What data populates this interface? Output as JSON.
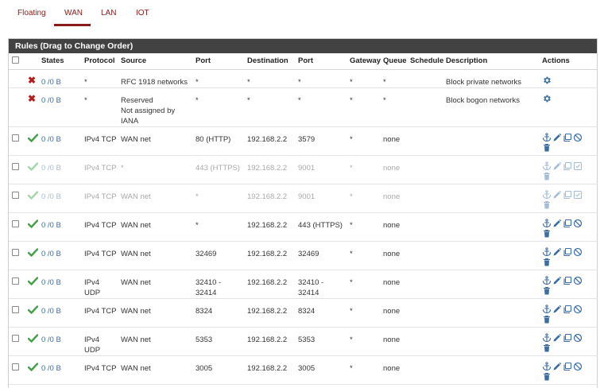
{
  "tabs": [
    {
      "label": "Floating"
    },
    {
      "label": "WAN",
      "active": true
    },
    {
      "label": "LAN"
    },
    {
      "label": "IOT"
    }
  ],
  "panel_title": "Rules (Drag to Change Order)",
  "columns": [
    "States",
    "Protocol",
    "Source",
    "Port",
    "Destination",
    "Port",
    "Gateway",
    "Queue",
    "Schedule",
    "Description",
    "Actions"
  ],
  "colors": {
    "accent": "#8b1a1a",
    "header_bg": "#424242",
    "link": "#3a6ea5",
    "pass_green": "#43a047",
    "block_red": "#b71c1c"
  },
  "rules": [
    {
      "kind": "block",
      "states": "0 /0 B",
      "protocol": "*",
      "source_lines": [
        "RFC 1918 networks"
      ],
      "port": "*",
      "destination": "*",
      "dest_port": "*",
      "gateway": "*",
      "queue": "*",
      "schedule": "",
      "description": "Block private networks",
      "action_icons": "settings"
    },
    {
      "kind": "block",
      "states": "0 /0 B",
      "protocol": "*",
      "source_lines": [
        "Reserved",
        "Not assigned by",
        "IANA"
      ],
      "port": "*",
      "destination": "*",
      "dest_port": "*",
      "gateway": "*",
      "queue": "*",
      "schedule": "",
      "description": "Block bogon networks",
      "action_icons": "settings"
    },
    {
      "kind": "pass",
      "states": "0 /0 B",
      "protocol": "IPv4 TCP",
      "source_lines": [
        "WAN net"
      ],
      "port": "80 (HTTP)",
      "destination": "192.168.2.2",
      "dest_port": "3579",
      "gateway": "*",
      "queue": "none",
      "schedule": "",
      "description": "",
      "action_icons": "enabled"
    },
    {
      "kind": "pass-disabled",
      "states": "0 /0 B",
      "protocol": "IPv4 TCP",
      "source_lines": [
        "*"
      ],
      "port": "443 (HTTPS)",
      "destination": "192.168.2.2",
      "dest_port": "9001",
      "gateway": "*",
      "queue": "none",
      "schedule": "",
      "description": "",
      "action_icons": "disabled"
    },
    {
      "kind": "pass-disabled",
      "states": "0 /0 B",
      "protocol": "IPv4 TCP",
      "source_lines": [
        "WAN net"
      ],
      "port": "*",
      "destination": "192.168.2.2",
      "dest_port": "9001",
      "gateway": "*",
      "queue": "none",
      "schedule": "",
      "description": "",
      "action_icons": "disabled"
    },
    {
      "kind": "pass",
      "states": "0 /0 B",
      "protocol": "IPv4 TCP",
      "source_lines": [
        "WAN net"
      ],
      "port": "*",
      "destination": "192.168.2.2",
      "dest_port": "443 (HTTPS)",
      "gateway": "*",
      "queue": "none",
      "schedule": "",
      "description": "",
      "action_icons": "enabled"
    },
    {
      "kind": "pass",
      "states": "0 /0 B",
      "protocol": "IPv4 TCP",
      "source_lines": [
        "WAN net"
      ],
      "port": "32469",
      "destination": "192.168.2.2",
      "dest_port": "32469",
      "gateway": "*",
      "queue": "none",
      "schedule": "",
      "description": "",
      "action_icons": "enabled"
    },
    {
      "kind": "pass",
      "states": "0 /0 B",
      "protocol": "IPv4\nUDP",
      "source_lines": [
        "WAN net"
      ],
      "port": "32410 -\n32414",
      "destination": "192.168.2.2",
      "dest_port": "32410 -\n32414",
      "gateway": "*",
      "queue": "none",
      "schedule": "",
      "description": "",
      "action_icons": "enabled"
    },
    {
      "kind": "pass",
      "states": "0 /0 B",
      "protocol": "IPv4 TCP",
      "source_lines": [
        "WAN net"
      ],
      "port": "8324",
      "destination": "192.168.2.2",
      "dest_port": "8324",
      "gateway": "*",
      "queue": "none",
      "schedule": "",
      "description": "",
      "action_icons": "enabled"
    },
    {
      "kind": "pass",
      "states": "0 /0 B",
      "protocol": "IPv4\nUDP",
      "source_lines": [
        "WAN net"
      ],
      "port": "5353",
      "destination": "192.168.2.2",
      "dest_port": "5353",
      "gateway": "*",
      "queue": "none",
      "schedule": "",
      "description": "",
      "action_icons": "enabled"
    },
    {
      "kind": "pass",
      "states": "0 /0 B",
      "protocol": "IPv4 TCP",
      "source_lines": [
        "WAN net"
      ],
      "port": "3005",
      "destination": "192.168.2.2",
      "dest_port": "3005",
      "gateway": "*",
      "queue": "none",
      "schedule": "",
      "description": "",
      "action_icons": "enabled"
    }
  ]
}
